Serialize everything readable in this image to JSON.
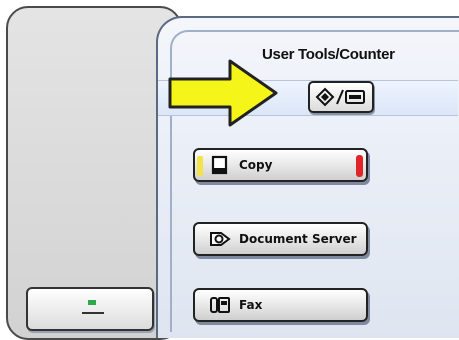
{
  "panel": {
    "title": "User Tools/Counter"
  },
  "buttons": {
    "user_tools": {
      "icon": "user-tools-counter-icon"
    },
    "copy": {
      "label": "Copy",
      "icon": "copy-icon",
      "led_left": "#f2e34a",
      "led_right": "#e0242a"
    },
    "document_server": {
      "label": "Document Server",
      "icon": "document-server-icon"
    },
    "fax": {
      "label": "Fax",
      "icon": "fax-icon"
    }
  },
  "arrow": {
    "icon": "pointer-arrow-icon",
    "color": "#f5f51a"
  }
}
